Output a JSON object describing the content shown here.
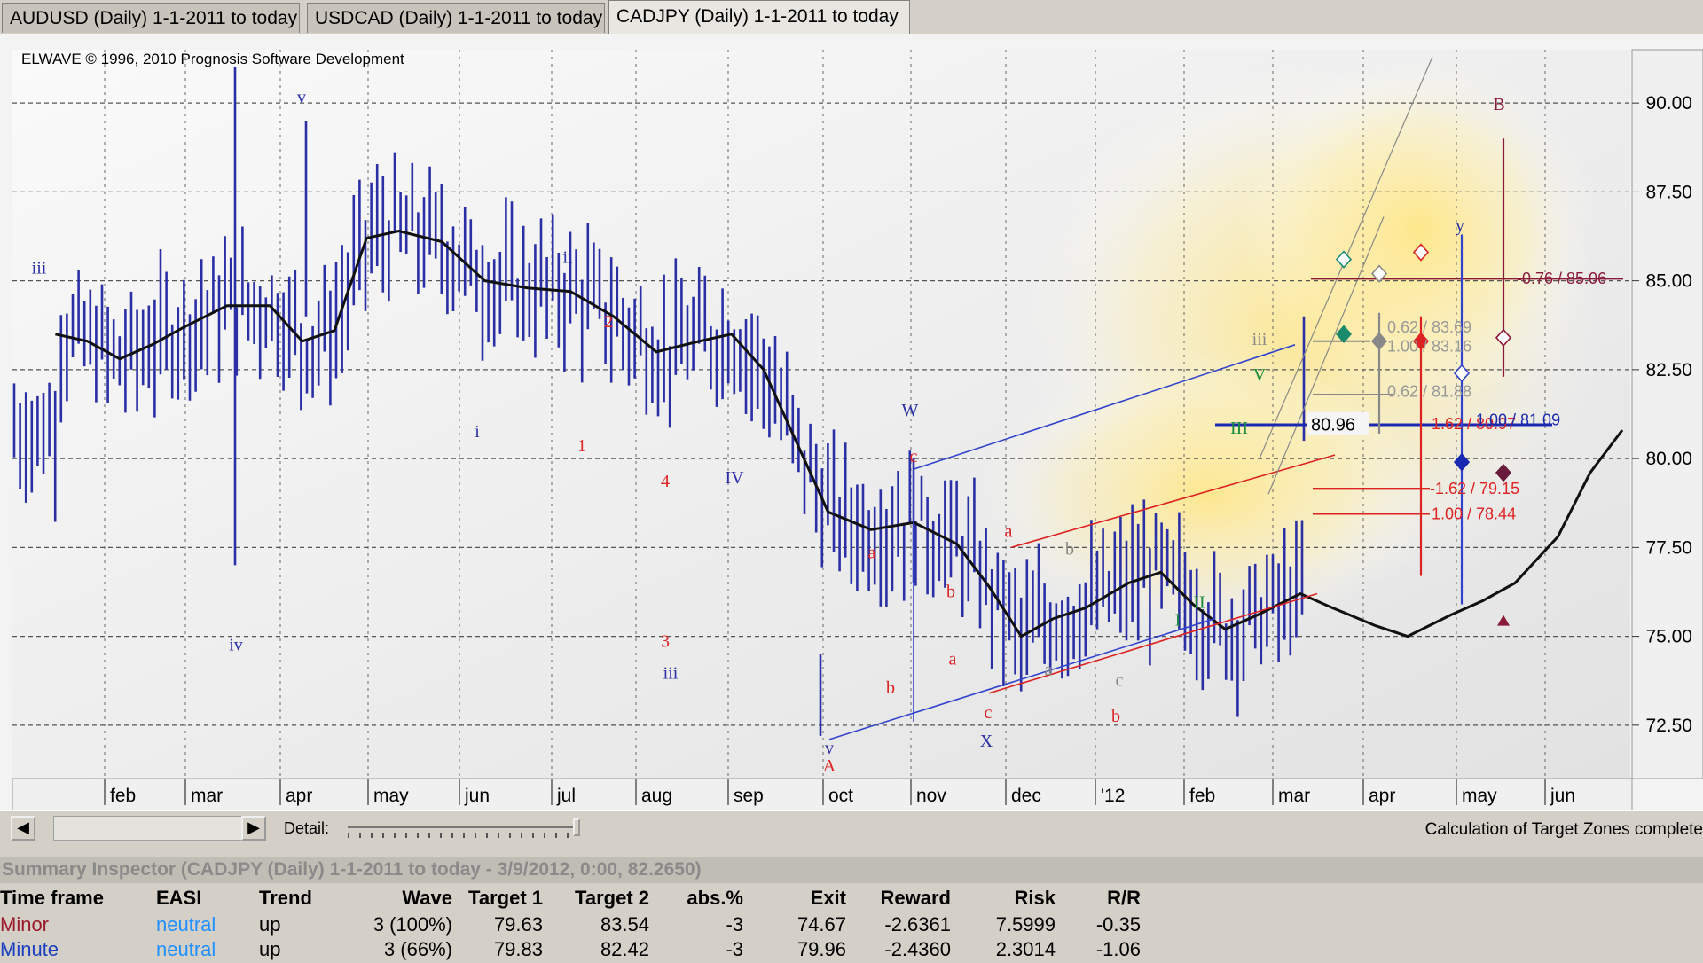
{
  "tabs": [
    {
      "label": "AUDUSD (Daily)  1-1-2011 to today",
      "active": false
    },
    {
      "label": "USDCAD (Daily)  1-1-2011 to today",
      "active": false
    },
    {
      "label": "CADJPY (Daily)  1-1-2011 to today",
      "active": true
    }
  ],
  "chart": {
    "copyright": "ELWAVE © 1996, 2010 Prognosis Software Development",
    "price_labels": [
      "90.00",
      "87.50",
      "85.00",
      "82.50",
      "80.00",
      "77.50",
      "75.00",
      "72.50"
    ],
    "month_labels": [
      "feb",
      "mar",
      "apr",
      "may",
      "jun",
      "jul",
      "aug",
      "sep",
      "oct",
      "nov",
      "dec",
      "'12",
      "feb",
      "mar",
      "apr",
      "may",
      "jun"
    ],
    "last_price_label": "80.96",
    "target_labels": {
      "t1": "-0.76 / 85.06",
      "t2": "0.62 / 83.69",
      "t3": "1.00 / 83.16",
      "t4": "0.62 / 81.88",
      "t5": "1.62 / 80.97",
      "t6": "1.00 / 81.09",
      "t7": "-1.62 / 79.15",
      "t8": "1.00 / 78.44"
    },
    "wave_labels": {
      "v_top": "v",
      "iii_left": "iii",
      "iv_left": "iv",
      "ii": "ii",
      "i": "i",
      "two": "2",
      "one": "1",
      "four": "4",
      "three": "3",
      "iii2": "iii",
      "IV": "IV",
      "W": "W",
      "v_low": "v",
      "A": "A",
      "c1": "c",
      "a1": "a",
      "b1": "b",
      "b2": "b",
      "a2": "a",
      "c2": "c",
      "X": "X",
      "a3": "a",
      "b3": "b",
      "a4": "a",
      "c3": "c",
      "b4": "b",
      "y": "y",
      "B": "B",
      "iii_g": "iii",
      "III": "III",
      "V": "V",
      "II": "II",
      "I": "I"
    }
  },
  "chart_data": {
    "type": "bar",
    "title": "",
    "ylim": [
      71.0,
      91.5
    ],
    "yticks": [
      72.5,
      75.0,
      77.5,
      80.0,
      82.5,
      85.0,
      87.5,
      90.0
    ],
    "moving_average": [
      [
        0.04,
        83.5
      ],
      [
        0.07,
        83.3
      ],
      [
        0.1,
        82.8
      ],
      [
        0.13,
        83.2
      ],
      [
        0.16,
        83.7
      ],
      [
        0.2,
        84.3
      ],
      [
        0.24,
        84.3
      ],
      [
        0.27,
        83.3
      ],
      [
        0.3,
        83.6
      ],
      [
        0.33,
        86.2
      ],
      [
        0.36,
        86.4
      ],
      [
        0.4,
        86.1
      ],
      [
        0.44,
        85.0
      ],
      [
        0.48,
        84.8
      ],
      [
        0.52,
        84.7
      ],
      [
        0.56,
        84.0
      ],
      [
        0.6,
        83.0
      ],
      [
        0.64,
        83.3
      ],
      [
        0.67,
        83.5
      ],
      [
        0.7,
        82.5
      ],
      [
        0.73,
        80.5
      ],
      [
        0.76,
        78.5
      ],
      [
        0.8,
        78.0
      ],
      [
        0.84,
        78.2
      ],
      [
        0.88,
        77.6
      ],
      [
        0.91,
        76.4
      ],
      [
        0.94,
        75.0
      ],
      [
        0.97,
        75.5
      ],
      [
        1.0,
        75.8
      ],
      [
        1.04,
        76.5
      ],
      [
        1.07,
        76.8
      ],
      [
        1.1,
        75.9
      ],
      [
        1.13,
        75.2
      ],
      [
        1.16,
        75.6
      ],
      [
        1.2,
        76.2
      ],
      [
        1.23,
        75.8
      ],
      [
        1.27,
        75.3
      ],
      [
        1.3,
        75.0
      ],
      [
        1.34,
        75.6
      ],
      [
        1.37,
        76.0
      ],
      [
        1.4,
        76.5
      ],
      [
        1.44,
        77.8
      ],
      [
        1.47,
        79.6
      ],
      [
        1.5,
        80.8
      ]
    ]
  },
  "scroll": {
    "left_arrow": "◀",
    "right_arrow": "▶",
    "detail_label": "Detail:"
  },
  "status": "Calculation of Target Zones complete",
  "inspector": {
    "title": "Summary Inspector (CADJPY (Daily)  1-1-2011 to today - 3/9/2012, 0:00, 82.2650)",
    "headers": [
      "Time frame",
      "EASI",
      "Trend",
      "Wave",
      "Target 1",
      "Target 2",
      "abs.%",
      "Exit",
      "Reward",
      "Risk",
      "R/R"
    ],
    "rows": [
      [
        "Minor",
        "neutral",
        "up",
        "3 (100%)",
        "79.63",
        "83.54",
        "-3",
        "74.67",
        "-2.6361",
        "7.5999",
        "-0.35"
      ],
      [
        "Minute",
        "neutral",
        "up",
        "3 (66%)",
        "79.83",
        "82.42",
        "-3",
        "79.96",
        "-2.4360",
        "2.3014",
        "-1.06"
      ]
    ],
    "row_colors": [
      "#9b1a2a",
      "#1a3fc0"
    ],
    "easi_color": "#1e90ff"
  }
}
